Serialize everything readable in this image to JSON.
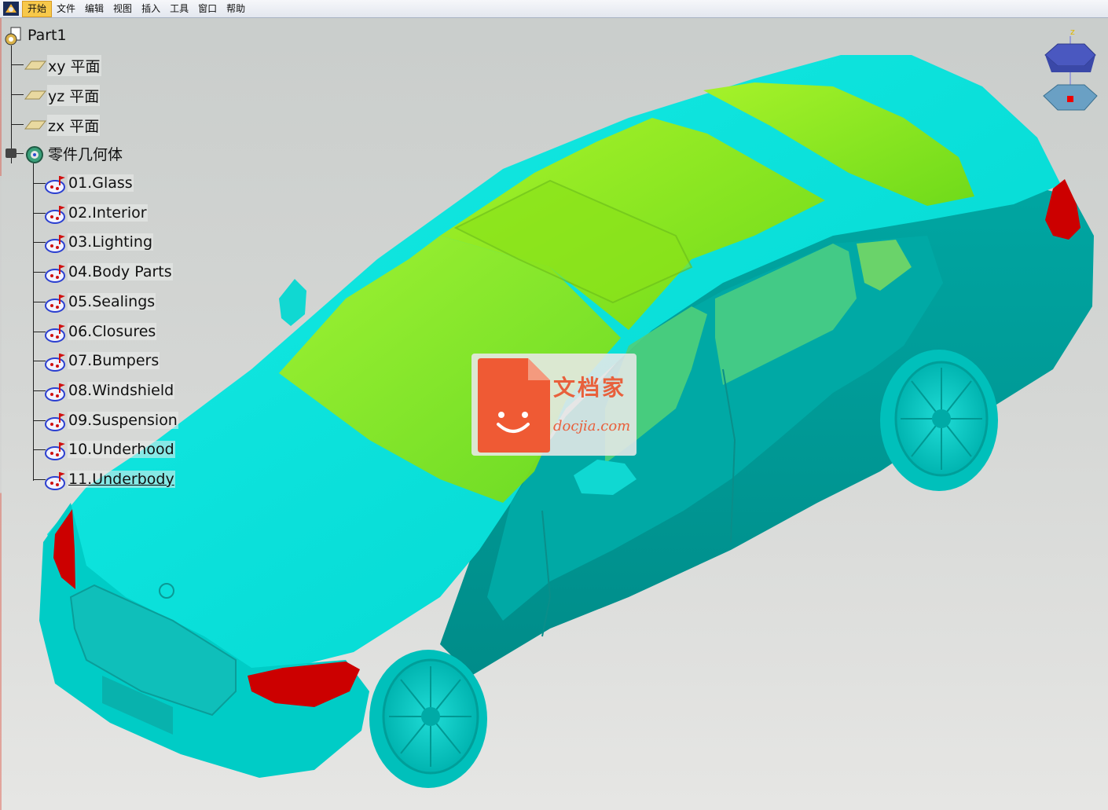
{
  "menubar": {
    "items": [
      "开始",
      "文件",
      "编辑",
      "视图",
      "插入",
      "工具",
      "窗口",
      "帮助"
    ],
    "active_index": 0
  },
  "tree": {
    "root": "Part1",
    "planes": [
      "xy 平面",
      "yz 平面",
      "zx 平面"
    ],
    "body": "零件几何体",
    "sets": [
      "01.Glass",
      "02.Interior",
      "03.Lighting",
      "04.Body Parts",
      "05.Sealings",
      "06.Closures",
      "07.Bumpers",
      "08.Windshield",
      "09.Suspension",
      "10.Underhood",
      "11.Underbody"
    ],
    "selected": "11.Underbody"
  },
  "compass": {
    "axis_label": "z"
  },
  "watermark": {
    "title": "文档家",
    "url": "docjia.com"
  },
  "colors": {
    "body": "#00c6c0",
    "glass": "#86e91a",
    "lights": "#cc0000",
    "menu_active": "#f7c84a"
  }
}
